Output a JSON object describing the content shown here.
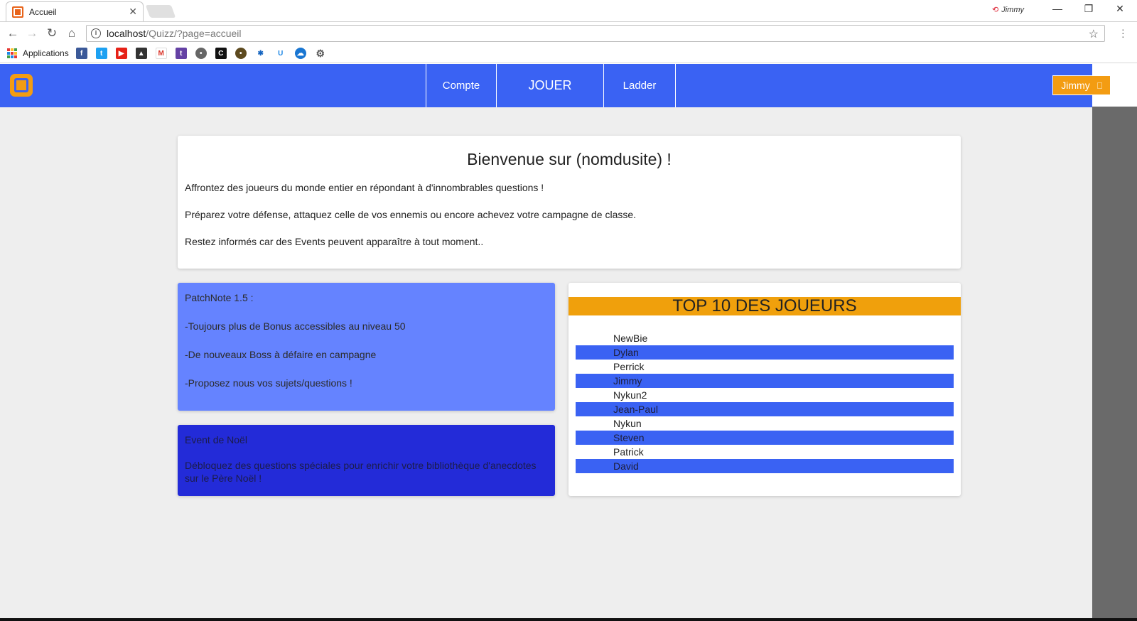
{
  "browser": {
    "tab_title": "Accueil",
    "tab_close": "✕",
    "profile_name": "Jimmy",
    "url_host": "localhost",
    "url_path": "/Quizz/?page=accueil",
    "bookmarks_label": "Applications",
    "window_controls": {
      "minimize": "—",
      "maximize": "❐",
      "close": "✕"
    }
  },
  "navbar": {
    "items": [
      {
        "label": "Compte"
      },
      {
        "label": "JOUER"
      },
      {
        "label": "Ladder"
      }
    ],
    "user_button": "Jimmy"
  },
  "welcome": {
    "title": "Bienvenue sur (nomdusite) !",
    "paragraphs": [
      "Affrontez des joueurs du monde entier en répondant à d'innombrables questions !",
      "Préparez votre défense, attaquez celle de vos ennemis ou encore achevez votre campagne de classe.",
      "Restez informés car des Events peuvent apparaître à tout moment.."
    ]
  },
  "patchnote": {
    "lines": [
      "PatchNote 1.5 :",
      "-Toujours plus de Bonus accessibles au niveau 50",
      "-De nouveaux Boss à défaire en campagne",
      "-Proposez nous vos sujets/questions !"
    ]
  },
  "event": {
    "title": "Event de Noël",
    "body": "Débloquez des questions spéciales pour enrichir votre bibliothèque d'anecdotes sur le Père Noël !"
  },
  "top10": {
    "title": "TOP 10 DES JOUEURS",
    "players": [
      "NewBie",
      "Dylan",
      "Perrick",
      "Jimmy",
      "Nykun2",
      "Jean-Paul",
      "Nykun",
      "Steven",
      "Patrick",
      "David"
    ]
  },
  "colors": {
    "navbar": "#3a62f3",
    "accent_orange": "#f39c12",
    "patch_bg": "#6583ff",
    "event_bg": "#232bd8"
  }
}
